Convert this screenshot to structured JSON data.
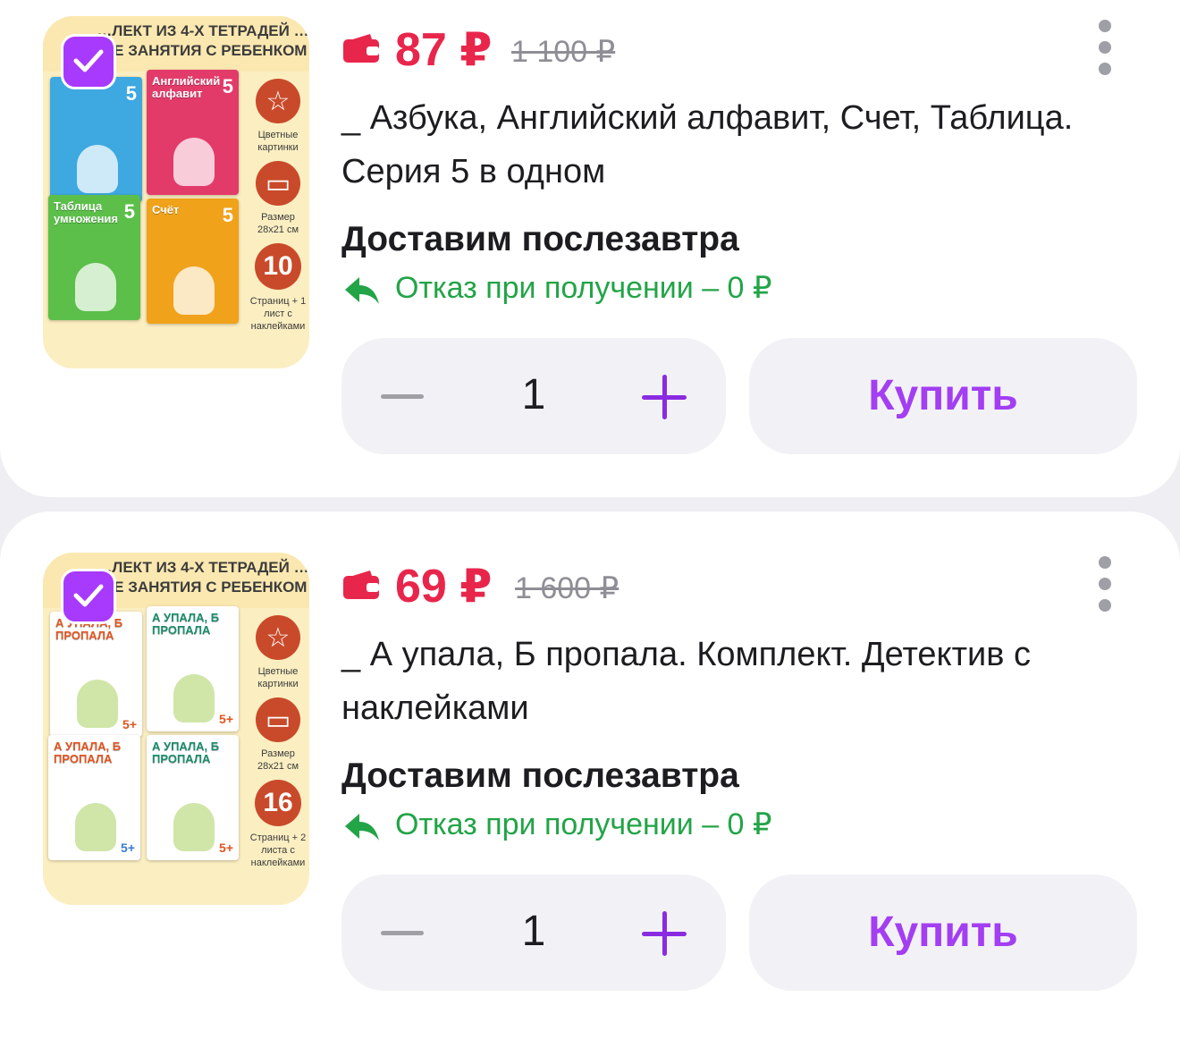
{
  "products": [
    {
      "selected": true,
      "image": {
        "header": "…ЛЕКТ ИЗ 4-Х ТЕТРАДЕЙ … ЫЕ ЗАНЯТИЯ С РЕБЕНКОМ",
        "books": [
          {
            "title": "",
            "num": "5",
            "color": "#3ea8e0"
          },
          {
            "title": "Английский алфавит",
            "num": "5",
            "color": "#e23b6a"
          },
          {
            "title": "Таблица умножения",
            "num": "5",
            "color": "#5bbf4a"
          },
          {
            "title": "Счёт",
            "num": "5",
            "color": "#f0a21b"
          }
        ],
        "side": {
          "colored": "Цветные картинки",
          "size": "Размер 28x21 см",
          "pages_num": "10",
          "pages_text": "Страниц + 1 лист с наклейками"
        }
      },
      "price": "87 ₽",
      "old_price": "1 100 ₽",
      "title": "_ Азбука, Английский алфавит, Счет, Таблица. Серия 5 в одном",
      "delivery": "Доставим послезавтра",
      "refusal": "Отказ при получении – 0 ₽",
      "quantity": "1",
      "buy_label": "Купить"
    },
    {
      "selected": true,
      "image": {
        "header": "…ЛЕКТ ИЗ 4-Х ТЕТРАДЕЙ … ЫЕ ЗАНЯТИЯ С РЕБЕНКОМ",
        "books": [
          {
            "title": "А УПАЛА, Б ПРОПАЛА",
            "num": "5+",
            "color": "#ffffff"
          },
          {
            "title": "А УПАЛА, Б ПРОПАЛА",
            "num": "5+",
            "color": "#ffffff"
          },
          {
            "title": "А УПАЛА, Б ПРОПАЛА",
            "num": "5+",
            "color": "#ffffff"
          },
          {
            "title": "А УПАЛА, Б ПРОПАЛА",
            "num": "5+",
            "color": "#ffffff"
          }
        ],
        "side": {
          "colored": "Цветные картинки",
          "size": "Размер 28x21 см",
          "pages_num": "16",
          "pages_text": "Страниц + 2 листа с наклейками"
        }
      },
      "price": "69 ₽",
      "old_price": "1 600 ₽",
      "title": "_ А упала, Б пропала. Комплект. Детектив с наклейками",
      "delivery": "Доставим послезавтра",
      "refusal": "Отказ при получении – 0 ₽",
      "quantity": "1",
      "buy_label": "Купить"
    }
  ],
  "colors": {
    "price": "#e8264b",
    "accent": "#a73afd",
    "refusal": "#22a447"
  }
}
